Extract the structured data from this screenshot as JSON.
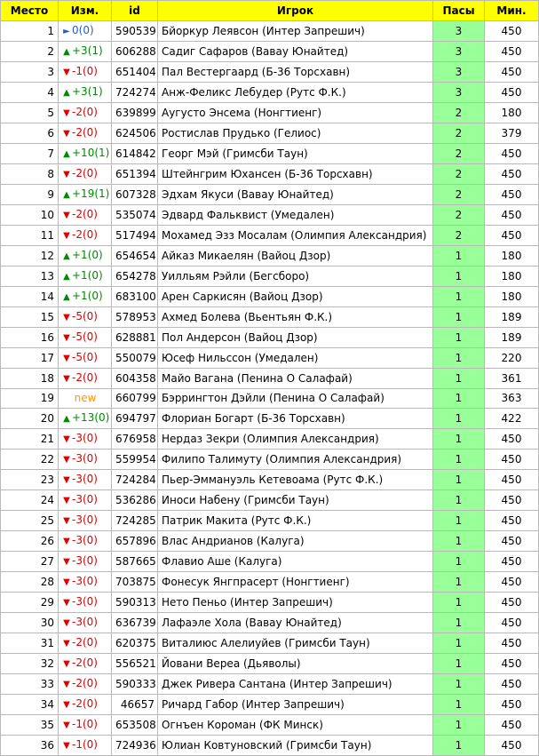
{
  "headers": {
    "place": "Место",
    "change": "Изм.",
    "id": "id",
    "player": "Игрок",
    "passes": "Пасы",
    "minutes": "Мин."
  },
  "icons": {
    "up": "triangle-up-icon",
    "down": "triangle-down-icon",
    "same": "triangle-right-icon"
  },
  "colors": {
    "header_bg": "#ffff00",
    "passes_bg": "#99ff99",
    "up": "#008a00",
    "down": "#e00000",
    "same": "#1e5fc8",
    "new": "#ff9900"
  },
  "rows": [
    {
      "place": "1",
      "dir": "same",
      "change": "0(0)",
      "id": "590539",
      "player": "Бйоркур Леявсон (Интер Запрешич)",
      "passes": "3",
      "minutes": "450"
    },
    {
      "place": "2",
      "dir": "up",
      "change": "+3(1)",
      "id": "606288",
      "player": "Садиг Сафаров (Вавау Юнайтед)",
      "passes": "3",
      "minutes": "450"
    },
    {
      "place": "3",
      "dir": "down",
      "change": "-1(0)",
      "id": "651404",
      "player": "Пал Вестергаард (Б-36 Торсхавн)",
      "passes": "3",
      "minutes": "450"
    },
    {
      "place": "4",
      "dir": "up",
      "change": "+3(1)",
      "id": "724274",
      "player": "Анж-Феликс Лебудер (Рутс Ф.К.)",
      "passes": "3",
      "minutes": "450"
    },
    {
      "place": "5",
      "dir": "down",
      "change": "-2(0)",
      "id": "639899",
      "player": "Аугусто Энсема (Нонгтиенг)",
      "passes": "2",
      "minutes": "180"
    },
    {
      "place": "6",
      "dir": "down",
      "change": "-2(0)",
      "id": "624506",
      "player": "Ростислав Прудько (Гелиос)",
      "passes": "2",
      "minutes": "379"
    },
    {
      "place": "7",
      "dir": "up",
      "change": "+10(1)",
      "id": "614842",
      "player": "Георг Мэй (Гримсби Таун)",
      "passes": "2",
      "minutes": "450"
    },
    {
      "place": "8",
      "dir": "down",
      "change": "-2(0)",
      "id": "651394",
      "player": "Штейнгрим Юхансен (Б-36 Торсхавн)",
      "passes": "2",
      "minutes": "450"
    },
    {
      "place": "9",
      "dir": "up",
      "change": "+19(1)",
      "id": "607328",
      "player": "Эдхам Якуси (Вавау Юнайтед)",
      "passes": "2",
      "minutes": "450"
    },
    {
      "place": "10",
      "dir": "down",
      "change": "-2(0)",
      "id": "535074",
      "player": "Эдвард Фальквист (Умедален)",
      "passes": "2",
      "minutes": "450"
    },
    {
      "place": "11",
      "dir": "down",
      "change": "-2(0)",
      "id": "517494",
      "player": "Мохамед Эзз Мосалам (Олимпия Александрия)",
      "passes": "2",
      "minutes": "450"
    },
    {
      "place": "12",
      "dir": "up",
      "change": "+1(0)",
      "id": "654654",
      "player": "Айказ Микаелян (Вайоц Дзор)",
      "passes": "1",
      "minutes": "180"
    },
    {
      "place": "13",
      "dir": "up",
      "change": "+1(0)",
      "id": "654278",
      "player": "Уилльям Рэйли (Бегсборо)",
      "passes": "1",
      "minutes": "180"
    },
    {
      "place": "14",
      "dir": "up",
      "change": "+1(0)",
      "id": "683100",
      "player": "Арен Саркисян (Вайоц Дзор)",
      "passes": "1",
      "minutes": "180"
    },
    {
      "place": "15",
      "dir": "down",
      "change": "-5(0)",
      "id": "578953",
      "player": "Ахмед Болева (Вьентьян Ф.К.)",
      "passes": "1",
      "minutes": "189"
    },
    {
      "place": "16",
      "dir": "down",
      "change": "-5(0)",
      "id": "628881",
      "player": "Пол Андерсон (Вайоц Дзор)",
      "passes": "1",
      "minutes": "189"
    },
    {
      "place": "17",
      "dir": "down",
      "change": "-5(0)",
      "id": "550079",
      "player": "Юсеф Нильссон (Умедален)",
      "passes": "1",
      "minutes": "220"
    },
    {
      "place": "18",
      "dir": "down",
      "change": "-2(0)",
      "id": "604358",
      "player": "Майо Вагана (Пенина О Салафай)",
      "passes": "1",
      "minutes": "361"
    },
    {
      "place": "19",
      "dir": "new",
      "change": "new",
      "id": "660799",
      "player": "Бэррингтон Дэйли (Пенина О Салафай)",
      "passes": "1",
      "minutes": "363"
    },
    {
      "place": "20",
      "dir": "up",
      "change": "+13(0)",
      "id": "694797",
      "player": "Флориан Богарт (Б-36 Торсхавн)",
      "passes": "1",
      "minutes": "422"
    },
    {
      "place": "21",
      "dir": "down",
      "change": "-3(0)",
      "id": "676958",
      "player": "Нердаз Зекри (Олимпия Александрия)",
      "passes": "1",
      "minutes": "450"
    },
    {
      "place": "22",
      "dir": "down",
      "change": "-3(0)",
      "id": "559954",
      "player": "Филипо Талимуту (Олимпия Александрия)",
      "passes": "1",
      "minutes": "450"
    },
    {
      "place": "23",
      "dir": "down",
      "change": "-3(0)",
      "id": "724284",
      "player": "Пьер-Эммануэль Кетевоама (Рутс Ф.К.)",
      "passes": "1",
      "minutes": "450"
    },
    {
      "place": "24",
      "dir": "down",
      "change": "-3(0)",
      "id": "536286",
      "player": "Иноси Набену (Гримсби Таун)",
      "passes": "1",
      "minutes": "450"
    },
    {
      "place": "25",
      "dir": "down",
      "change": "-3(0)",
      "id": "724285",
      "player": "Патрик Макита (Рутс Ф.К.)",
      "passes": "1",
      "minutes": "450"
    },
    {
      "place": "26",
      "dir": "down",
      "change": "-3(0)",
      "id": "657896",
      "player": "Влас Андрианов (Калуга)",
      "passes": "1",
      "minutes": "450"
    },
    {
      "place": "27",
      "dir": "down",
      "change": "-3(0)",
      "id": "587665",
      "player": "Флавио Аше (Калуга)",
      "passes": "1",
      "minutes": "450"
    },
    {
      "place": "28",
      "dir": "down",
      "change": "-3(0)",
      "id": "703875",
      "player": "Фонесук Янгпрасерт (Нонгтиенг)",
      "passes": "1",
      "minutes": "450"
    },
    {
      "place": "29",
      "dir": "down",
      "change": "-3(0)",
      "id": "590313",
      "player": "Нето Пеньо (Интер Запрешич)",
      "passes": "1",
      "minutes": "450"
    },
    {
      "place": "30",
      "dir": "down",
      "change": "-3(0)",
      "id": "636739",
      "player": "Лафаэле Хола (Вавау Юнайтед)",
      "passes": "1",
      "minutes": "450"
    },
    {
      "place": "31",
      "dir": "down",
      "change": "-2(0)",
      "id": "620375",
      "player": "Виталиюс Алелиуйев (Гримсби Таун)",
      "passes": "1",
      "minutes": "450"
    },
    {
      "place": "32",
      "dir": "down",
      "change": "-2(0)",
      "id": "556521",
      "player": "Йовани Вереа (Дьяволы)",
      "passes": "1",
      "minutes": "450"
    },
    {
      "place": "33",
      "dir": "down",
      "change": "-2(0)",
      "id": "590333",
      "player": "Джек Ривера Сантана (Интер Запрешич)",
      "passes": "1",
      "minutes": "450"
    },
    {
      "place": "34",
      "dir": "down",
      "change": "-2(0)",
      "id": "46657",
      "player": "Ричард Габор (Интер Запрешич)",
      "passes": "1",
      "minutes": "450"
    },
    {
      "place": "35",
      "dir": "down",
      "change": "-1(0)",
      "id": "653508",
      "player": "Огнъен Короман (ФК Минск)",
      "passes": "1",
      "minutes": "450"
    },
    {
      "place": "36",
      "dir": "down",
      "change": "-1(0)",
      "id": "724936",
      "player": "Юлиан Ковтуновский (Гримсби Таун)",
      "passes": "1",
      "minutes": "450"
    }
  ]
}
